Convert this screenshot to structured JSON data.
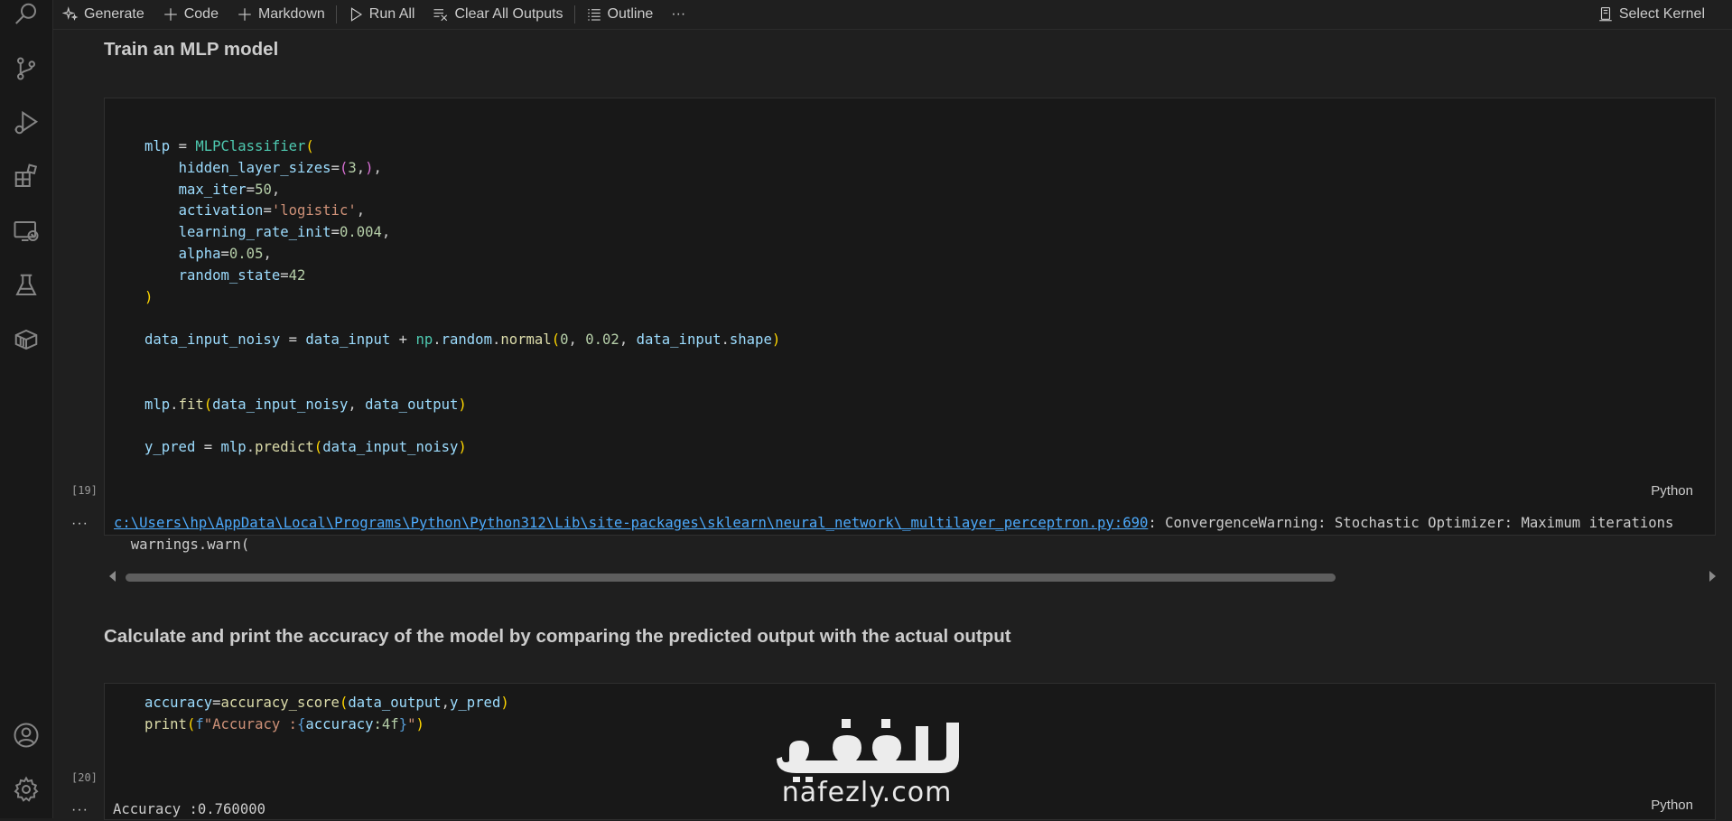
{
  "toolbar": {
    "generate": "Generate",
    "code": "Code",
    "markdown": "Markdown",
    "run_all": "Run All",
    "clear_outputs": "Clear All Outputs",
    "outline": "Outline",
    "more": "···",
    "select_kernel": "Select Kernel"
  },
  "activity_bar": [
    "search-icon",
    "source-control-icon",
    "run-debug-icon",
    "extensions-icon",
    "remote-explorer-icon",
    "testing-icon",
    "package-icon",
    "account-icon",
    "settings-gear-icon"
  ],
  "cells": [
    {
      "heading": "Train an MLP model"
    },
    {
      "execution_count": "[19]",
      "language": "Python",
      "output_dots": "···",
      "output_path": "c:\\Users\\hp\\AppData\\Local\\Programs\\Python\\Python312\\Lib\\site-packages\\sklearn\\neural_network\\_multilayer_perceptron.py:690",
      "output_message": ": ConvergenceWarning: Stochastic Optimizer: Maximum iterations",
      "output_line2": "  warnings.warn("
    },
    {
      "heading": "Calculate and print the accuracy of the model by comparing the predicted output with the actual output"
    },
    {
      "execution_count": "[20]",
      "language": "Python",
      "output_dots": "···",
      "output_text": "Accuracy :0.760000"
    }
  ],
  "watermark": {
    "arabic": "نفذلي",
    "latin": "nafezly.com"
  },
  "colors": {
    "background": "#1f1f1f",
    "code_background": "#181818",
    "link": "#4daafc",
    "function": "#dcdcaa",
    "variable": "#9cdcfe",
    "number": "#b5cea8",
    "string": "#ce9178",
    "class": "#4ec9b0"
  }
}
